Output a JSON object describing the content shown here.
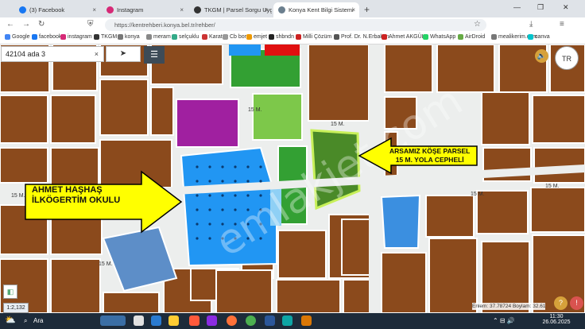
{
  "browser": {
    "tabs": [
      {
        "title": "(3) Facebook",
        "favicon_color": "#1877f2"
      },
      {
        "title": "Instagram",
        "favicon_color": "#d62976"
      },
      {
        "title": "TKGM | Parsel Sorgu Uygulamas",
        "favicon_color": "#333333"
      },
      {
        "title": "Konya Kent Bilgi Sistemi",
        "favicon_color": "#6b7f8e"
      }
    ],
    "new_tab": "+",
    "url": "https://kentrehberi.konya.bel.tr/rehber/",
    "bookmarks": [
      "Google",
      "facebook",
      "instagram",
      "TKGM",
      "konya",
      "meram",
      "selçuklu",
      "Karatay",
      "Cb borsa",
      "emjet",
      "shbndn",
      "Milli Çözüm",
      "Prof. Dr. N.Erbakan",
      "Ahmet AKGÜL",
      "WhatsApp",
      "AirDroid",
      "mealikerim.com",
      "canva"
    ]
  },
  "map_ui": {
    "search_value": "42104 ada 3",
    "clear_glyph": "×",
    "scale_label": "1:2,132",
    "coordinates": "Enlem: 37.78724 Boylam: 32.61500",
    "road_labels": [
      "15 M.",
      "15 M.",
      "15 M.",
      "15 M.",
      "15 M.",
      "15 M."
    ]
  },
  "annotations": {
    "school_line1": "AHMET HAŞHAŞ",
    "school_line2": "İLKÖGERTİM OKULU",
    "parcel_line1": "ARSAMIZ KÖŞE PARSEL",
    "parcel_line2": "15 M. YOLA CEPHELİ",
    "watermark": "emlakjet.com"
  },
  "taskbar": {
    "search_label": "Ara",
    "time": "11:30",
    "date": "26.06.2025"
  },
  "colors": {
    "parcel_brown": "#8b4a1c",
    "school_blue": "#2196f3",
    "green_area": "#33a033",
    "highlight_green": "#6ba83a",
    "purple": "#a020a0",
    "arrow_yellow": "#ffff00"
  }
}
